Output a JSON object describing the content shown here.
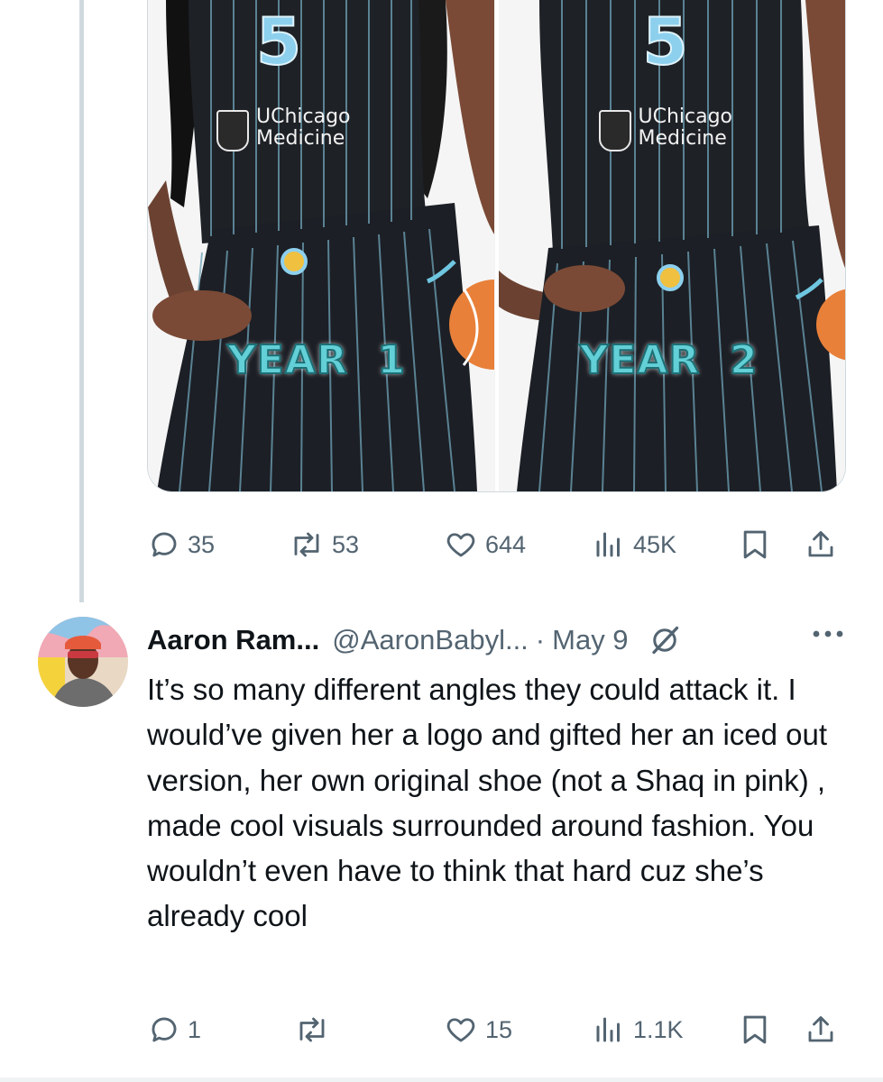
{
  "media": {
    "photos": [
      {
        "number": "5",
        "sponsor_line1": "UChicago",
        "sponsor_line2": "Medicine",
        "caption": "YEAR  1"
      },
      {
        "number": "5",
        "sponsor_line1": "UChicago",
        "sponsor_line2": "Medicine",
        "caption": "YEAR  2"
      }
    ]
  },
  "main_tweet": {
    "actions": {
      "replies": "35",
      "reposts": "53",
      "likes": "644",
      "views": "45K"
    }
  },
  "reply": {
    "author_name": "Aaron Ram...",
    "handle": "@AaronBabyl...",
    "separator": "·",
    "date": "May 9",
    "text": "It’s so many different angles they could attack it. I would’ve given her a logo and gifted her an iced out version, her own original shoe (not a Shaq in pink) , made cool visuals surrounded around fashion. You wouldn’t even have to think that hard cuz she’s already cool",
    "actions": {
      "replies": "1",
      "reposts": "",
      "likes": "15",
      "views": "1.1K"
    }
  },
  "icons": {
    "reply": "speech-bubble-icon",
    "repost": "repost-arrows-icon",
    "like": "heart-icon",
    "views": "bar-chart-icon",
    "bookmark": "bookmark-icon",
    "share": "share-upload-icon",
    "grok": "grok-slash-icon",
    "more": "more-dots-icon"
  },
  "colors": {
    "text": "#0f1419",
    "secondary": "#536471",
    "border": "#cfd9de"
  }
}
